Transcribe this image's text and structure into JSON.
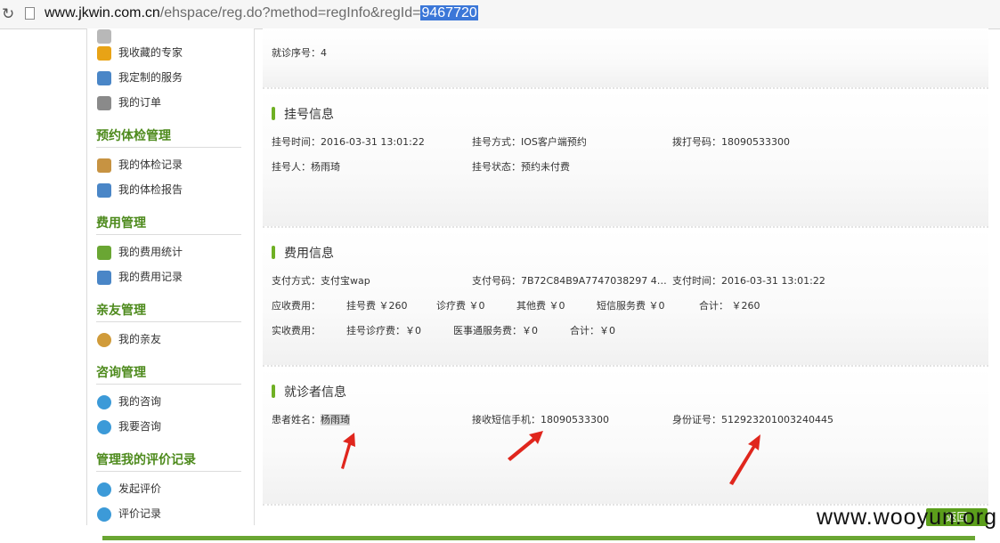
{
  "browser": {
    "url_host": "www.jkwin.com.cn",
    "url_path": "/ehspace/reg.do?method=regInfo&regId=",
    "url_selected": "9467720"
  },
  "sidebar": {
    "items_top": [
      {
        "label": "我收藏的专家",
        "icon": "star-icon",
        "color": "#e8a316"
      },
      {
        "label": "我定制的服务",
        "icon": "calendar-icon",
        "color": "#4a86c7"
      },
      {
        "label": "我的订单",
        "icon": "order-icon",
        "color": "#8a8a8a"
      }
    ],
    "groups": [
      {
        "title": "预约体检管理",
        "items": [
          {
            "label": "我的体检记录",
            "icon": "user-edit-icon",
            "color": "#c79342"
          },
          {
            "label": "我的体检报告",
            "icon": "report-icon",
            "color": "#4a86c7"
          }
        ]
      },
      {
        "title": "费用管理",
        "items": [
          {
            "label": "我的费用统计",
            "icon": "stats-icon",
            "color": "#6aa633"
          },
          {
            "label": "我的费用记录",
            "icon": "records-icon",
            "color": "#4a86c7"
          }
        ]
      },
      {
        "title": "亲友管理",
        "items": [
          {
            "label": "我的亲友",
            "icon": "friends-icon",
            "color": "#d09b3a"
          }
        ]
      },
      {
        "title": "咨询管理",
        "items": [
          {
            "label": "我的咨询",
            "icon": "chat-icon",
            "color": "#3c9ad8"
          },
          {
            "label": "我要咨询",
            "icon": "search-icon",
            "color": "#3c9ad8"
          }
        ]
      },
      {
        "title": "管理我的评价记录",
        "items": [
          {
            "label": "发起评价",
            "icon": "comment-icon",
            "color": "#3c9ad8"
          },
          {
            "label": "评价记录",
            "icon": "search-icon",
            "color": "#3c9ad8"
          }
        ]
      }
    ]
  },
  "main": {
    "visit_seq": {
      "label": "就诊序号：",
      "value": "4"
    },
    "reg": {
      "title": "挂号信息",
      "time": "挂号时间：2016-03-31 13:01:22",
      "method": "挂号方式：IOS客户端预约",
      "phone": "拨打号码：18090533300",
      "person": "挂号人：杨雨琦",
      "status": "挂号状态：预约未付费"
    },
    "fee": {
      "title": "费用信息",
      "pay_method": "支付方式：支付宝wap",
      "pay_no": "支付号码：7B72C84B9A7747038297 4B7CE…",
      "pay_time": "支付时间：2016-03-31 13:01:22",
      "receivable": "应收费用：",
      "reg_fee": "挂号费 ￥260",
      "diag_fee": "诊疗费 ￥0",
      "other_fee": "其他费 ￥0",
      "sms_fee": "短信服务费 ￥0",
      "total1": "合计： ￥260",
      "received": "实收费用：",
      "reg_diag_fee": "挂号诊疗费：￥0",
      "med_fee": "医事通服务费：￥0",
      "total2": "合计：￥0"
    },
    "patient": {
      "title": "就诊者信息",
      "name_label": "患者姓名：",
      "name_value": "杨雨琦",
      "sms_phone": "接收短信手机：18090533300",
      "id_card": "身份证号：512923201003240445"
    }
  },
  "back_button": "返回",
  "watermark": "www.wooyun.org",
  "colors": {
    "accent": "#6aa633",
    "heading": "#4d8a1c",
    "arrow": "#e0261d",
    "selection": "#3b77d8"
  }
}
